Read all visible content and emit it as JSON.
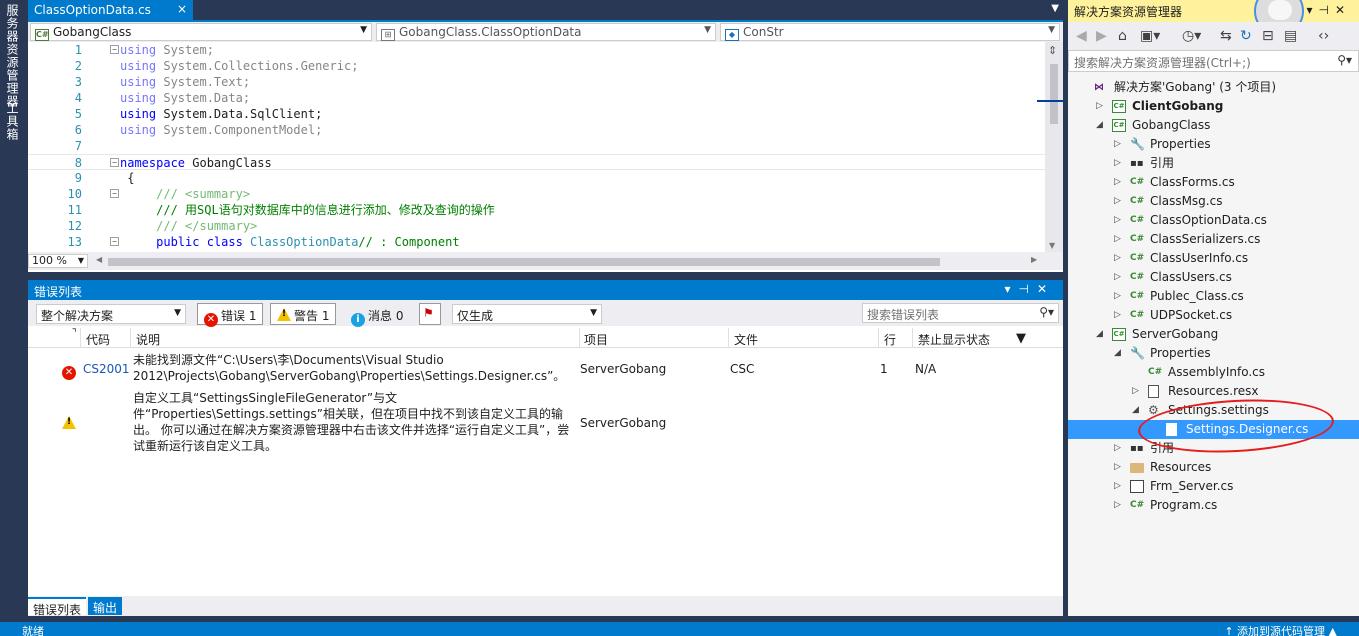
{
  "left_strip": {
    "tabs": [
      "服务器资源管理器",
      "工具箱"
    ]
  },
  "editor": {
    "tab_title": "ClassOptionData.cs",
    "tab_close": "×",
    "nav": {
      "project": "GobangClass",
      "class": "GobangClass.ClassOptionData",
      "member": "ConStr"
    },
    "lines": [
      {
        "n": "1",
        "parts": [
          [
            "kw",
            "using"
          ],
          [
            "",
            " System;"
          ]
        ],
        "dim": true,
        "fold": "−"
      },
      {
        "n": "2",
        "parts": [
          [
            "kw",
            "using"
          ],
          [
            "",
            " System.Collections.Generic;"
          ]
        ],
        "dim": true
      },
      {
        "n": "3",
        "parts": [
          [
            "kw",
            "using"
          ],
          [
            "",
            " System.Text;"
          ]
        ],
        "dim": true
      },
      {
        "n": "4",
        "parts": [
          [
            "kw",
            "using"
          ],
          [
            "",
            " System.Data;"
          ]
        ],
        "dim": true
      },
      {
        "n": "5",
        "parts": [
          [
            "kw",
            "using"
          ],
          [
            "",
            " System.Data.SqlClient;"
          ]
        ]
      },
      {
        "n": "6",
        "parts": [
          [
            "kw",
            "using"
          ],
          [
            "",
            " System.ComponentModel;"
          ]
        ],
        "dim": true
      },
      {
        "n": "7",
        "parts": [
          [
            "",
            ""
          ]
        ]
      },
      {
        "n": "8",
        "parts": [
          [
            "kw",
            "namespace"
          ],
          [
            "",
            " GobangClass"
          ]
        ],
        "fold": "−",
        "highlight": true
      },
      {
        "n": "9",
        "parts": [
          [
            "",
            " {"
          ]
        ]
      },
      {
        "n": "10",
        "parts": [
          [
            "cm",
            "     /// <summary>"
          ]
        ],
        "fold": "−",
        "dimcm": true
      },
      {
        "n": "11",
        "parts": [
          [
            "cm",
            "     /// 用SQL语句对数据库中的信息进行添加、修改及查询的操作"
          ]
        ]
      },
      {
        "n": "12",
        "parts": [
          [
            "cm",
            "     /// </summary>"
          ]
        ],
        "dimcm": true
      },
      {
        "n": "13",
        "parts": [
          [
            "kw",
            "     public class "
          ],
          [
            "ty",
            "ClassOptionData"
          ],
          [
            "cm",
            "// : Component"
          ]
        ],
        "fold": "−"
      }
    ],
    "zoom": "100 %"
  },
  "error_list": {
    "title": "错误列表",
    "scope": "整个解决方案",
    "errors_btn": "错误 1",
    "warnings_btn": "警告 1",
    "messages_btn": "消息 0",
    "build_filter": "仅生成",
    "search_placeholder": "搜索错误列表",
    "columns": [
      "代码",
      "说明",
      "项目",
      "文件",
      "行",
      "禁止显示状态"
    ],
    "rows": [
      {
        "type": "error",
        "code": "CS2001",
        "desc": "未能找到源文件“C:\\Users\\李\\Documents\\Visual Studio 2012\\Projects\\Gobang\\ServerGobang\\Properties\\Settings.Designer.cs”。",
        "project": "ServerGobang",
        "file": "CSC",
        "line": "1",
        "suppress": "N/A"
      },
      {
        "type": "warning",
        "code": "",
        "desc": "自定义工具“SettingsSingleFileGenerator”与文件“Properties\\Settings.settings”相关联，但在项目中找不到该自定义工具的输出。 你可以通过在解决方案资源管理器中右击该文件并选择“运行自定义工具”，尝试重新运行该自定义工具。",
        "project": "ServerGobang",
        "file": "",
        "line": "",
        "suppress": ""
      }
    ],
    "bottom_tabs": [
      "错误列表",
      "输出"
    ]
  },
  "status": {
    "left": "就绪",
    "right": "↑ 添加到源代码管理 ▲"
  },
  "solution_explorer": {
    "title": "解决方案资源管理器",
    "search_placeholder": "搜索解决方案资源管理器(Ctrl+;)",
    "items": [
      {
        "label": "解决方案'Gobang' (3 个项目)",
        "indent": 0,
        "exp": "",
        "icon": "sln",
        "bold": false
      },
      {
        "label": "ClientGobang",
        "indent": 1,
        "exp": "▷",
        "icon": "csproj",
        "bold": true
      },
      {
        "label": "GobangClass",
        "indent": 1,
        "exp": "◢",
        "icon": "csproj"
      },
      {
        "label": "Properties",
        "indent": 2,
        "exp": "▷",
        "icon": "wrench"
      },
      {
        "label": "引用",
        "indent": 2,
        "exp": "▷",
        "icon": "ref"
      },
      {
        "label": "ClassForms.cs",
        "indent": 2,
        "exp": "▷",
        "icon": "csfile"
      },
      {
        "label": "ClassMsg.cs",
        "indent": 2,
        "exp": "▷",
        "icon": "csfile"
      },
      {
        "label": "ClassOptionData.cs",
        "indent": 2,
        "exp": "▷",
        "icon": "csfile"
      },
      {
        "label": "ClassSerializers.cs",
        "indent": 2,
        "exp": "▷",
        "icon": "csfile"
      },
      {
        "label": "ClassUserInfo.cs",
        "indent": 2,
        "exp": "▷",
        "icon": "csfile"
      },
      {
        "label": "ClassUsers.cs",
        "indent": 2,
        "exp": "▷",
        "icon": "csfile"
      },
      {
        "label": "Publec_Class.cs",
        "indent": 2,
        "exp": "▷",
        "icon": "csfile"
      },
      {
        "label": "UDPSocket.cs",
        "indent": 2,
        "exp": "▷",
        "icon": "csfile"
      },
      {
        "label": "ServerGobang",
        "indent": 1,
        "exp": "◢",
        "icon": "csproj"
      },
      {
        "label": "Properties",
        "indent": 2,
        "exp": "◢",
        "icon": "wrench"
      },
      {
        "label": "AssemblyInfo.cs",
        "indent": 3,
        "exp": "",
        "icon": "csfile"
      },
      {
        "label": "Resources.resx",
        "indent": 3,
        "exp": "▷",
        "icon": "file"
      },
      {
        "label": "Settings.settings",
        "indent": 3,
        "exp": "◢",
        "icon": "gear"
      },
      {
        "label": "Settings.Designer.cs",
        "indent": 4,
        "exp": "",
        "icon": "file",
        "selected": true
      },
      {
        "label": "引用",
        "indent": 2,
        "exp": "▷",
        "icon": "ref"
      },
      {
        "label": "Resources",
        "indent": 2,
        "exp": "▷",
        "icon": "folder"
      },
      {
        "label": "Frm_Server.cs",
        "indent": 2,
        "exp": "▷",
        "icon": "form"
      },
      {
        "label": "Program.cs",
        "indent": 2,
        "exp": "▷",
        "icon": "csfile"
      }
    ]
  }
}
